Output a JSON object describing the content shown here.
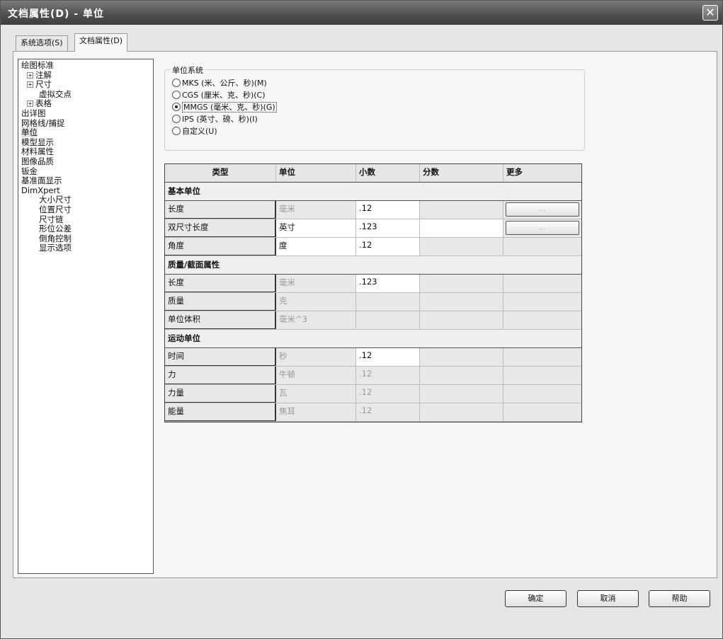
{
  "window": {
    "title": "文档属性(D) - 单位"
  },
  "tabs": [
    {
      "label": "系统选项(S)"
    },
    {
      "label": "文档属性(D)"
    }
  ],
  "tree": [
    {
      "label": "绘图标准",
      "level": 0
    },
    {
      "label": "注解",
      "level": 1,
      "expander": "+"
    },
    {
      "label": "尺寸",
      "level": 1,
      "expander": "+"
    },
    {
      "label": "虚拟交点",
      "level": 2
    },
    {
      "label": "表格",
      "level": 1,
      "expander": "+"
    },
    {
      "label": "出详图",
      "level": 0
    },
    {
      "label": "网格线/捕捉",
      "level": 0
    },
    {
      "label": "单位",
      "level": 0,
      "selected": true
    },
    {
      "label": "模型显示",
      "level": 0
    },
    {
      "label": "材料属性",
      "level": 0
    },
    {
      "label": "图像品质",
      "level": 0
    },
    {
      "label": "钣金",
      "level": 0
    },
    {
      "label": "基准面显示",
      "level": 0
    },
    {
      "label": "DimXpert",
      "level": 0
    },
    {
      "label": "大小尺寸",
      "level": 2
    },
    {
      "label": "位置尺寸",
      "level": 2
    },
    {
      "label": "尺寸链",
      "level": 2
    },
    {
      "label": "形位公差",
      "level": 2
    },
    {
      "label": "倒角控制",
      "level": 2
    },
    {
      "label": "显示选项",
      "level": 2
    }
  ],
  "unit_system": {
    "legend": "单位系统",
    "options": [
      {
        "label": "MKS (米、公斤、秒)(M)",
        "checked": false
      },
      {
        "label": "CGS (厘米、克、秒)(C)",
        "checked": false
      },
      {
        "label": "MMGS (毫米、克、秒)(G)",
        "checked": true
      },
      {
        "label": "IPS (英寸、磅、秒)(I)",
        "checked": false
      },
      {
        "label": "自定义(U)",
        "checked": false
      }
    ]
  },
  "table": {
    "headers": [
      "类型",
      "单位",
      "小数",
      "分数",
      "更多"
    ],
    "sections": [
      {
        "title": "基本单位",
        "rows": [
          {
            "type": "长度",
            "unit": "毫米",
            "unit_enabled": false,
            "decimal": ".12",
            "decimal_enabled": true,
            "fraction_white": false,
            "more_button": "..."
          },
          {
            "type": "双尺寸长度",
            "unit": "英寸",
            "unit_enabled": true,
            "decimal": ".123",
            "decimal_enabled": true,
            "fraction_white": true,
            "more_button": "..."
          },
          {
            "type": "角度",
            "unit": "度",
            "unit_enabled": true,
            "decimal": ".12",
            "decimal_enabled": true,
            "fraction_white": false,
            "more_button": ""
          }
        ]
      },
      {
        "title": "质量/截面属性",
        "rows": [
          {
            "type": "长度",
            "unit": "毫米",
            "unit_enabled": false,
            "decimal": ".123",
            "decimal_enabled": true,
            "fraction_white": false,
            "more_button": ""
          },
          {
            "type": "质量",
            "unit": "克",
            "unit_enabled": false,
            "decimal": "",
            "decimal_enabled": false,
            "fraction_white": false,
            "more_button": ""
          },
          {
            "type": "单位体积",
            "unit": "毫米^3",
            "unit_enabled": false,
            "decimal": "",
            "decimal_enabled": false,
            "fraction_white": false,
            "more_button": ""
          }
        ]
      },
      {
        "title": "运动单位",
        "rows": [
          {
            "type": "时间",
            "unit": "秒",
            "unit_enabled": false,
            "decimal": ".12",
            "decimal_enabled": true,
            "fraction_white": false,
            "more_button": ""
          },
          {
            "type": "力",
            "unit": "牛顿",
            "unit_enabled": false,
            "decimal": ".12",
            "decimal_enabled": false,
            "fraction_white": false,
            "more_button": ""
          },
          {
            "type": "力量",
            "unit": "瓦",
            "unit_enabled": false,
            "decimal": ".12",
            "decimal_enabled": false,
            "fraction_white": false,
            "more_button": ""
          },
          {
            "type": "能量",
            "unit": "焦耳",
            "unit_enabled": false,
            "decimal": ".12",
            "decimal_enabled": false,
            "fraction_white": false,
            "more_button": ""
          }
        ]
      }
    ]
  },
  "buttons": {
    "ok": "确定",
    "cancel": "取消",
    "help": "帮助"
  },
  "colors": {
    "titlebar": "#4e4e4e",
    "panel": "#f6f6f6",
    "disabled_text": "#9a9a9a"
  }
}
